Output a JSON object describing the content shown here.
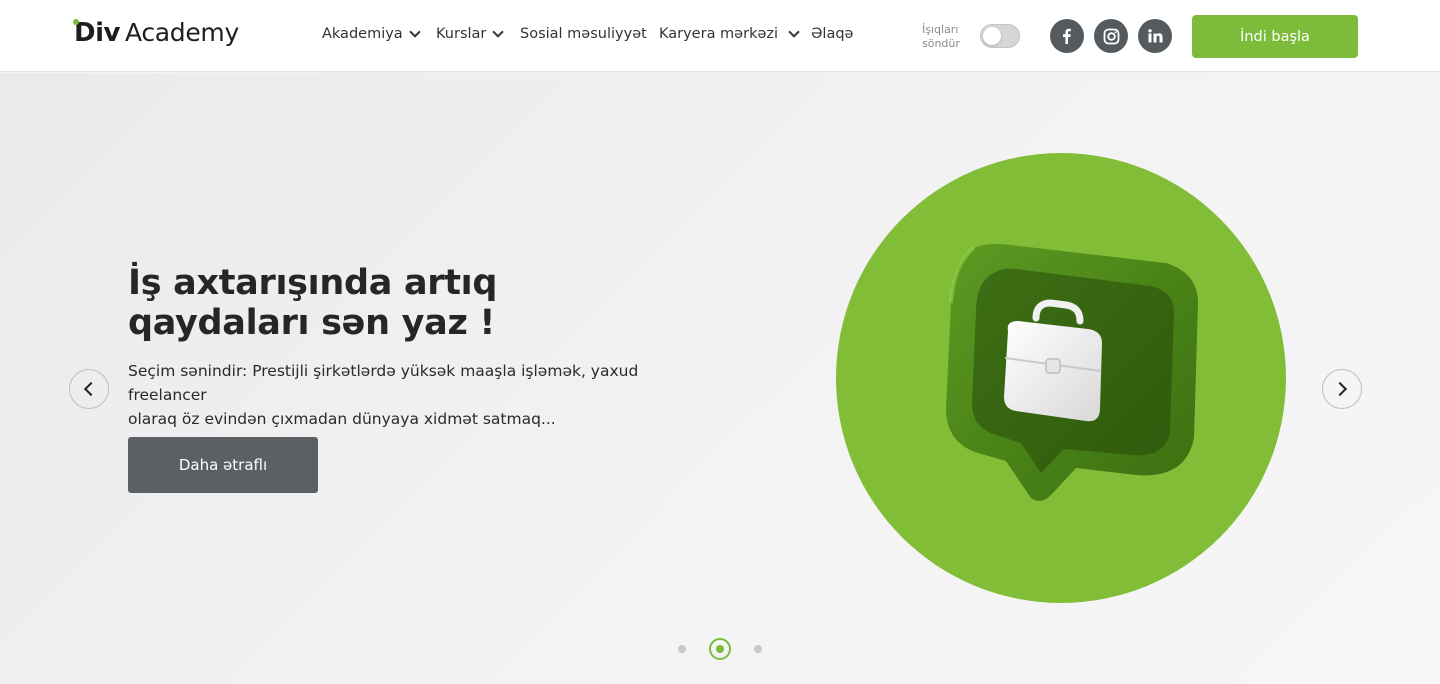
{
  "header": {
    "logo": {
      "div": "Div",
      "academy": "Academy"
    },
    "nav": [
      {
        "label": "Akademiya",
        "dropdown": true
      },
      {
        "label": "Kurslar",
        "dropdown": true
      },
      {
        "label": "Sosial məsuliyyət",
        "dropdown": false
      },
      {
        "label": "Karyera mərkəzi",
        "dropdown": true
      },
      {
        "label": "Əlaqə",
        "dropdown": false
      }
    ],
    "lights_label_line1": "İşıqları",
    "lights_label_line2": "söndür",
    "social_icons": [
      "facebook-icon",
      "instagram-icon",
      "linkedin-icon"
    ],
    "cta_label": "İndi başla"
  },
  "hero": {
    "title_line1": "İş axtarışında artıq",
    "title_line2": "qaydaları sən yaz !",
    "description_line1": "Seçim sənindir: Prestijli şirkətlərdə yüksək maaşla işləmək, yaxud freelancer",
    "description_line2": "olaraq öz evindən çıxmadan dünyaya xidmət satmaq...",
    "button_label": "Daha ətraflı",
    "illustration": "briefcase-chat-bubble-icon",
    "slides_total": 3,
    "active_slide": 2
  },
  "colors": {
    "brand_green": "#7dbb3a",
    "circle_green": "#82bd38",
    "dark_button": "#5a6063",
    "social_bg": "#545a5e"
  }
}
